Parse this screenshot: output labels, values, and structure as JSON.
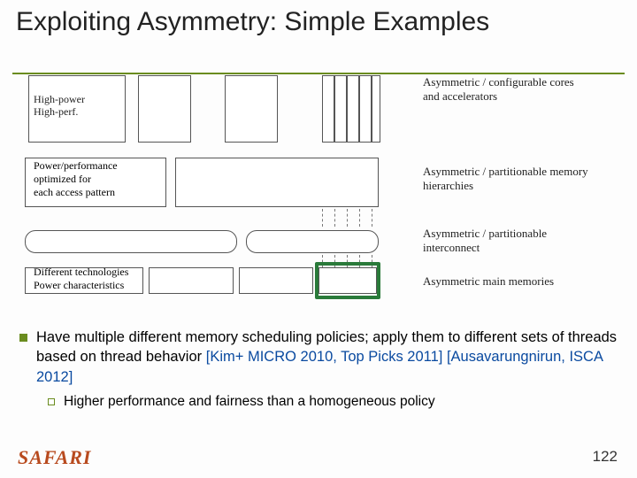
{
  "title": "Exploiting Asymmetry: Simple Examples",
  "diagram": {
    "core_big_label": "High-power\nHigh-perf.",
    "row1_right": "Asymmetric / configurable cores and accelerators",
    "mem_label": "Power/performance\noptimized for\neach access pattern",
    "row2_right": "Asymmetric / partitionable memory hierarchies",
    "row3_right": "Asymmetric / partitionable interconnect",
    "mm_label": "Different technologies\nPower characteristics",
    "row4_right": "Asymmetric main memories"
  },
  "bullets": {
    "main": "Have multiple different memory scheduling policies; apply them to different sets of threads based on thread behavior ",
    "cite": "[Kim+ MICRO 2010, Top Picks 2011] [Ausavarungnirun, ISCA 2012]",
    "sub": "Higher performance and fairness than a homogeneous policy"
  },
  "footer": {
    "logo": "SAFARI",
    "page": "122"
  }
}
